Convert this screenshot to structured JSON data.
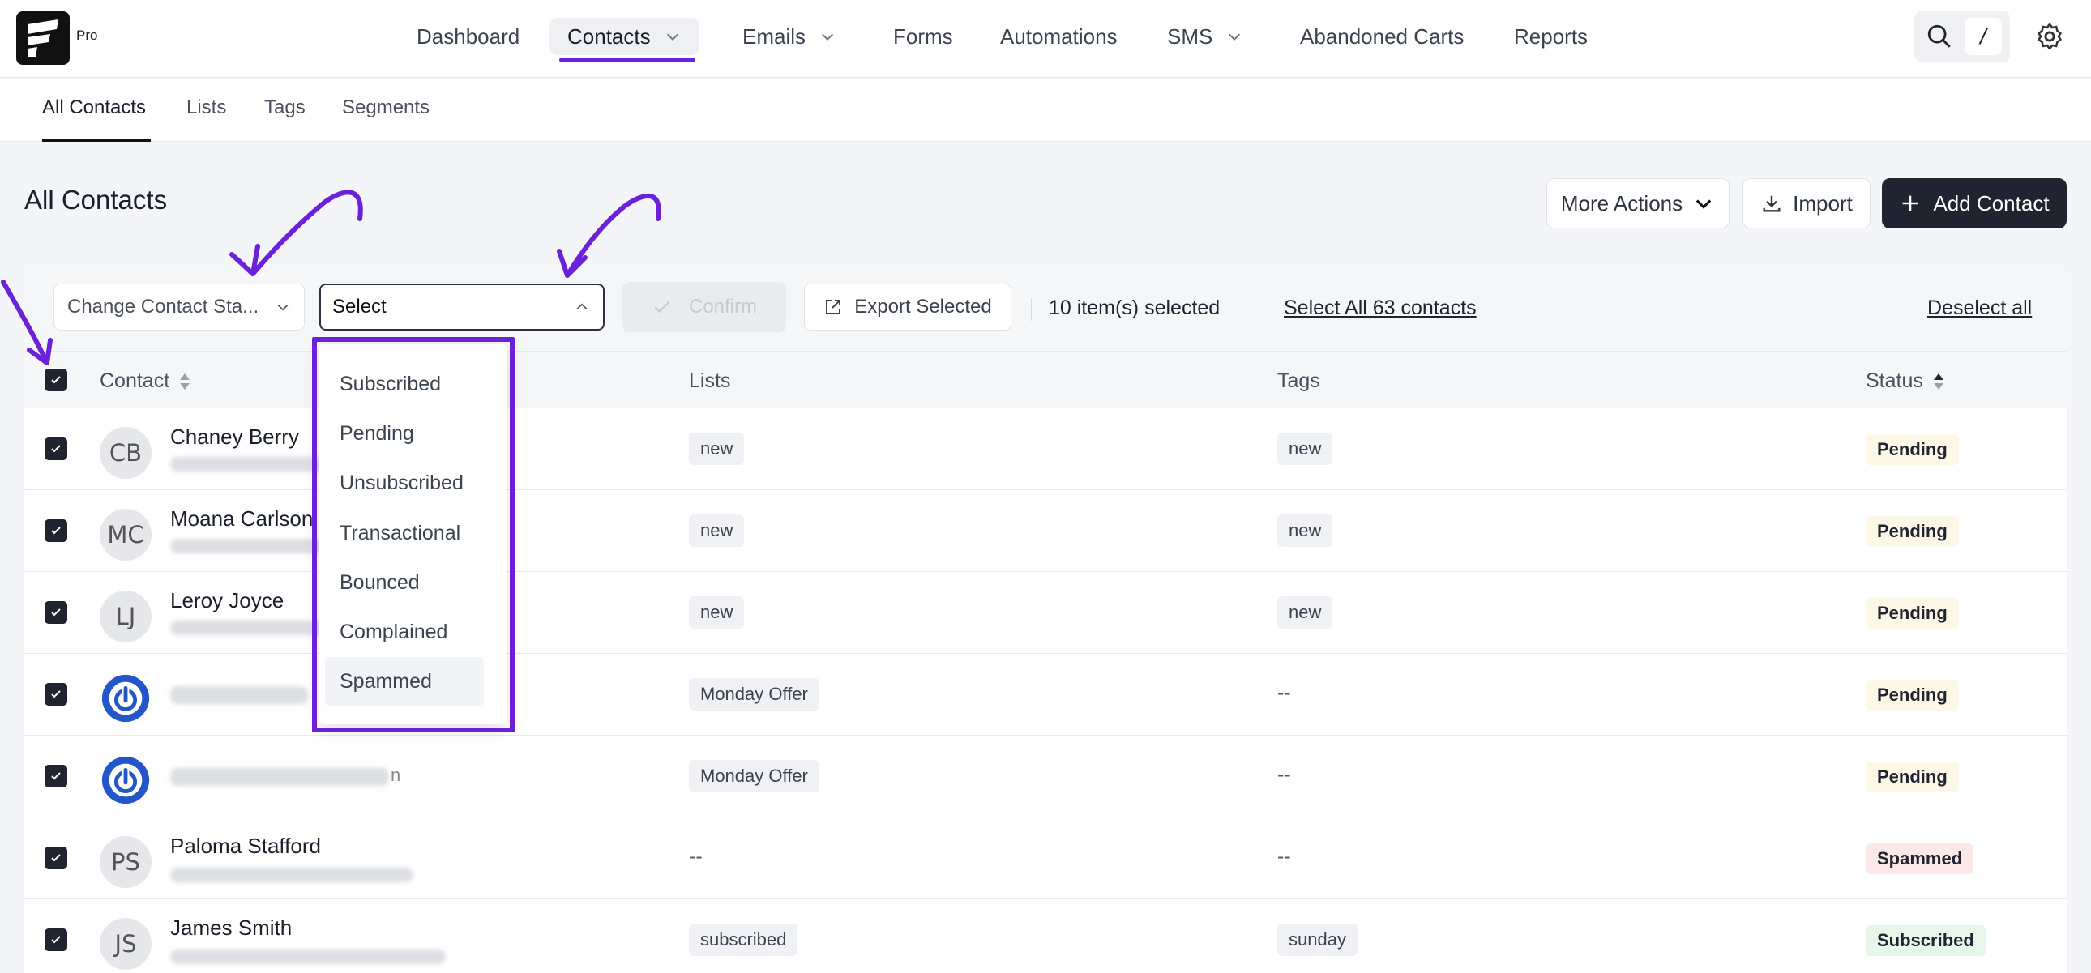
{
  "brand": {
    "pro_label": "Pro"
  },
  "nav": {
    "items": [
      {
        "label": "Dashboard"
      },
      {
        "label": "Contacts"
      },
      {
        "label": "Emails"
      },
      {
        "label": "Forms"
      },
      {
        "label": "Automations"
      },
      {
        "label": "SMS"
      },
      {
        "label": "Abandoned Carts"
      },
      {
        "label": "Reports"
      }
    ],
    "shortcut_key": "/"
  },
  "subnav": {
    "items": [
      {
        "label": "All Contacts"
      },
      {
        "label": "Lists"
      },
      {
        "label": "Tags"
      },
      {
        "label": "Segments"
      }
    ]
  },
  "page": {
    "title": "All Contacts",
    "more_actions": "More Actions",
    "import": "Import",
    "add_contact": "Add Contact"
  },
  "toolbar": {
    "change_status": "Change Contact Sta...",
    "select_value": "Select",
    "confirm": "Confirm",
    "export_selected": "Export Selected",
    "selected_count": "10 item(s) selected",
    "select_all": "Select All 63 contacts",
    "deselect_all": "Deselect all"
  },
  "table": {
    "headers": {
      "contact": "Contact",
      "lists": "Lists",
      "tags": "Tags",
      "status": "Status"
    },
    "rows": [
      {
        "initials": "CB",
        "name": "Chaney Berry",
        "list": "new",
        "tag": "new",
        "status": "Pending"
      },
      {
        "initials": "MC",
        "name": "Moana Carlson",
        "list": "new",
        "tag": "new",
        "status": "Pending"
      },
      {
        "initials": "LJ",
        "name": "Leroy Joyce",
        "list": "new",
        "tag": "new",
        "status": "Pending"
      },
      {
        "initials": "",
        "name": "",
        "list": "Monday Offer",
        "tag": "--",
        "status": "Pending"
      },
      {
        "initials": "",
        "name": "",
        "name_suffix": "n",
        "list": "Monday Offer",
        "tag": "--",
        "status": "Pending"
      },
      {
        "initials": "PS",
        "name": "Paloma Stafford",
        "list": "--",
        "tag": "--",
        "status": "Spammed"
      },
      {
        "initials": "JS",
        "name": "James Smith",
        "list": "subscribed",
        "tag": "sunday",
        "status": "Subscribed"
      }
    ]
  },
  "status_dropdown": {
    "options": [
      "Subscribed",
      "Pending",
      "Unsubscribed",
      "Transactional",
      "Bounced",
      "Complained",
      "Spammed"
    ]
  },
  "colors": {
    "accent": "#6b21d8",
    "dark": "#1f2430"
  }
}
